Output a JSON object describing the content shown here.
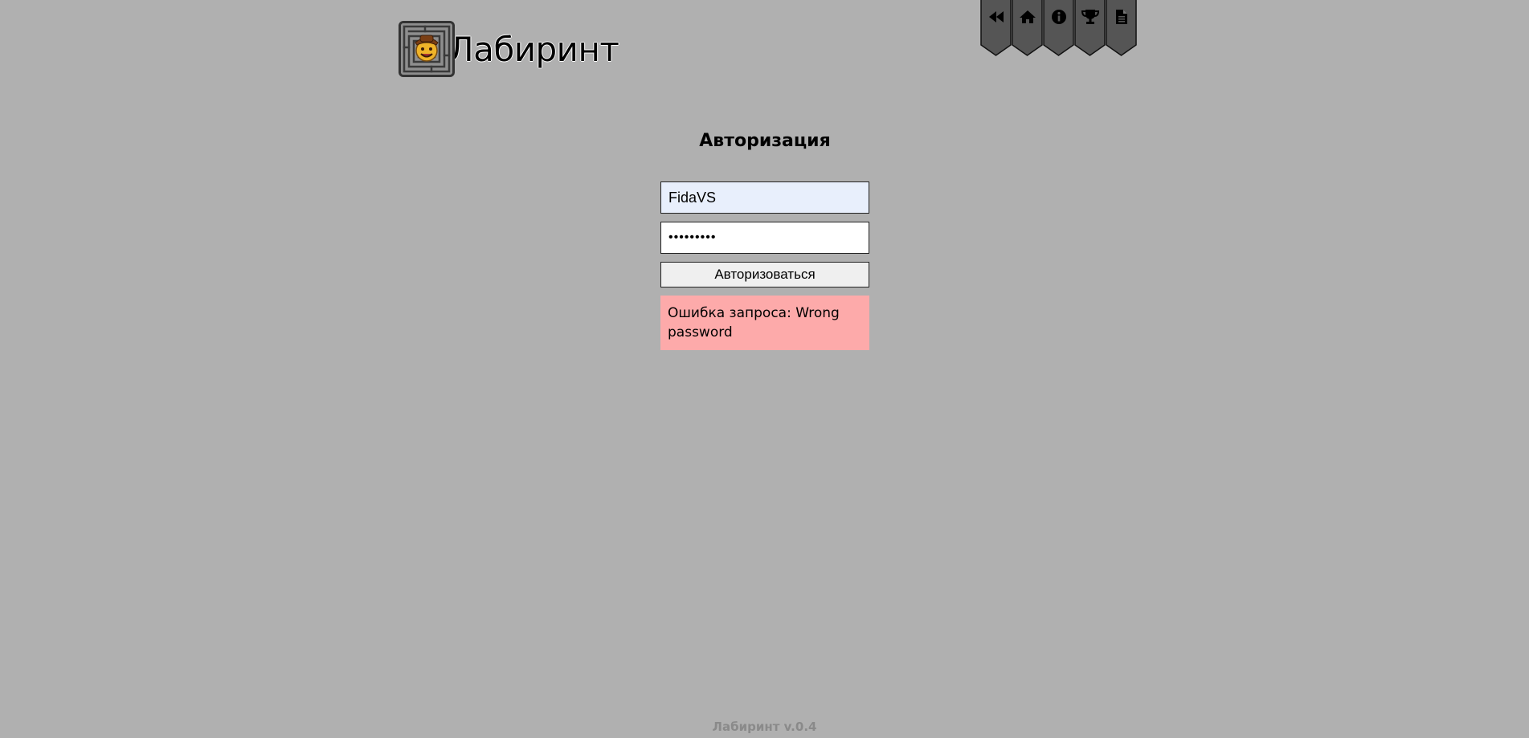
{
  "header": {
    "app_title": "Лабиринт",
    "nav": [
      {
        "icon": "rewind-icon",
        "name": "nav-back"
      },
      {
        "icon": "home-icon",
        "name": "nav-home"
      },
      {
        "icon": "info-icon",
        "name": "nav-info"
      },
      {
        "icon": "trophy-icon",
        "name": "nav-leaderboard"
      },
      {
        "icon": "document-icon",
        "name": "nav-rules"
      }
    ]
  },
  "auth": {
    "title": "Авторизация",
    "login_value": "FidaVS",
    "password_value": "•••••••••",
    "submit_label": "Авторизоваться",
    "error_text": "Ошибка запроса: Wrong password"
  },
  "footer": {
    "version": "Лабиринт v.0.4"
  },
  "colors": {
    "background": "#b0b0b0",
    "nav_tab": "#555555",
    "error_bg": "#fdaaaa",
    "autofill_bg": "#e8effc",
    "footer_text": "#8a8a8a"
  }
}
